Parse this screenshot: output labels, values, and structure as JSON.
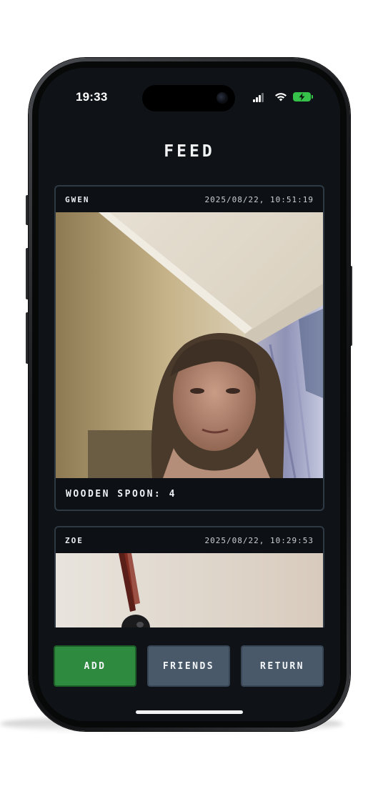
{
  "status_bar": {
    "time": "19:33",
    "signal_icon": "cellular-signal-icon",
    "wifi_icon": "wifi-icon",
    "battery_icon": "battery-charging-icon",
    "battery_color": "#36c24a"
  },
  "header": {
    "title": "FEED"
  },
  "feed": {
    "posts": [
      {
        "user": "GWEN",
        "timestamp": "2025/08/22, 10:51:19",
        "caption": "WOODEN SPOON: 4"
      },
      {
        "user": "ZOE",
        "timestamp": "2025/08/22, 10:29:53",
        "caption": ""
      }
    ]
  },
  "actions": {
    "add_label": "ADD",
    "add_color": "#2e8a3e",
    "friends_label": "FRIENDS",
    "return_label": "RETURN",
    "secondary_color": "#4a5969"
  },
  "theme": {
    "background": "#0f1317",
    "card_border": "#2e3944"
  }
}
